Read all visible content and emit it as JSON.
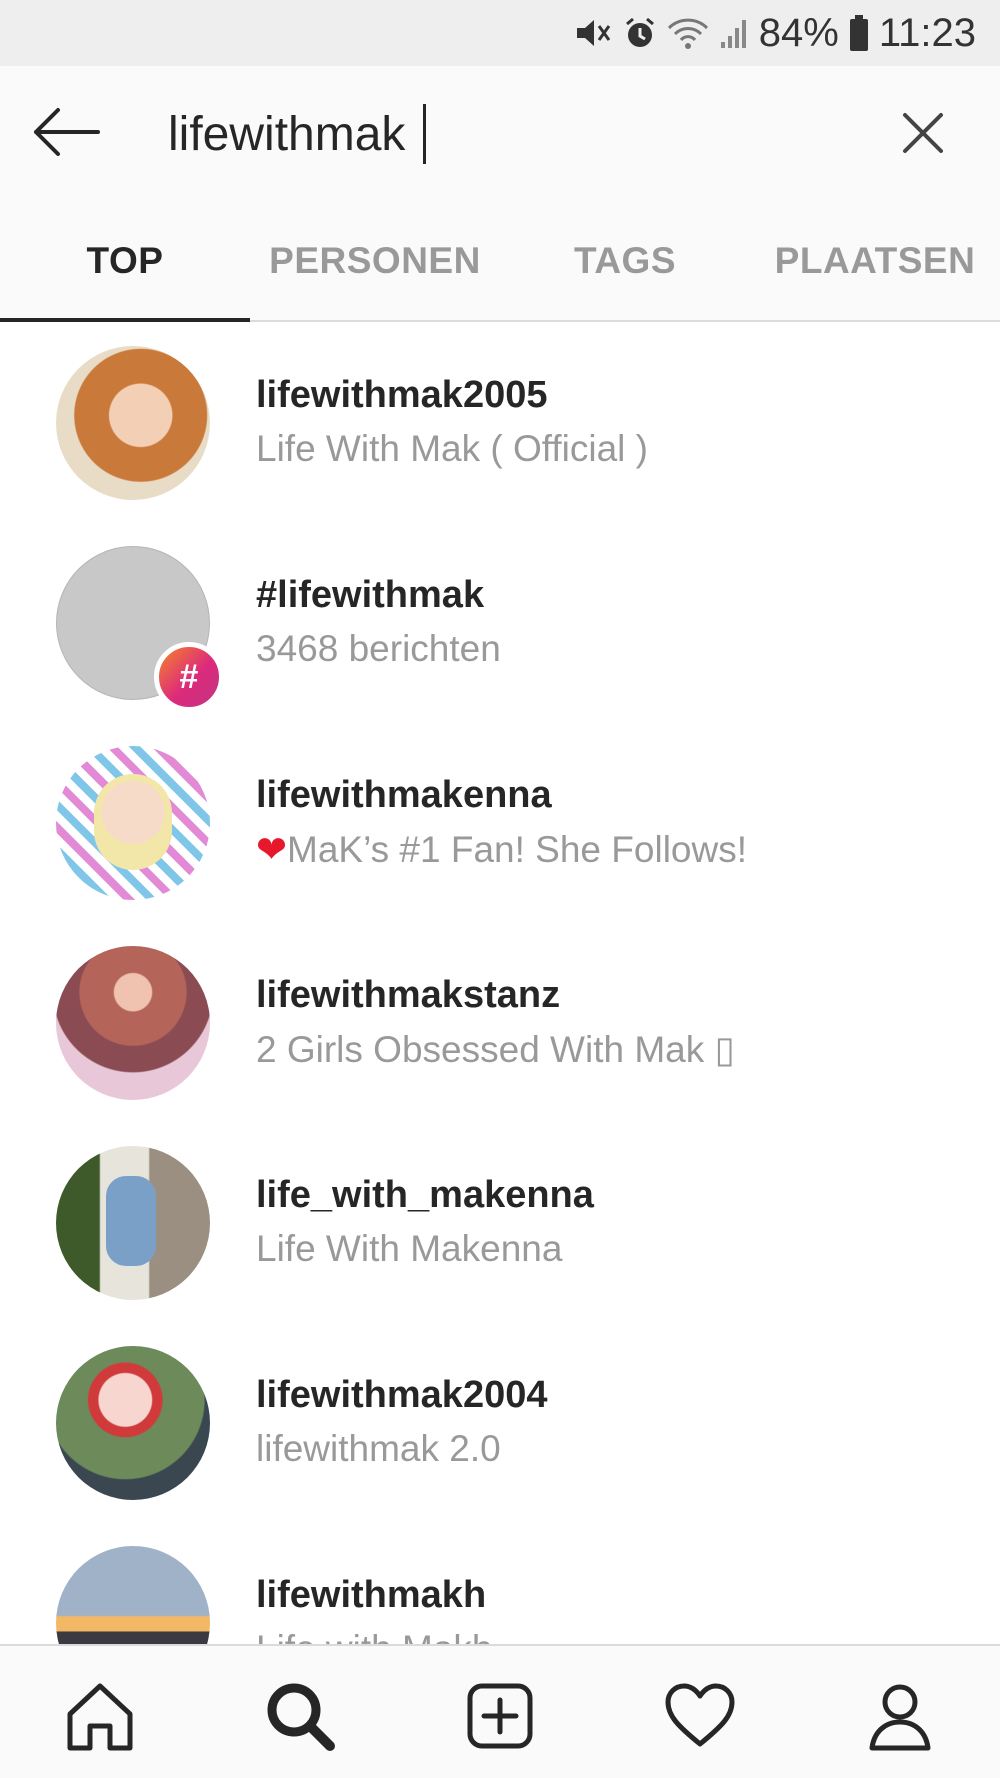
{
  "status_bar": {
    "battery": "84%",
    "time": "11:23",
    "icons": [
      "mute-icon",
      "alarm-icon",
      "wifi-icon",
      "signal-icon",
      "battery-icon"
    ]
  },
  "search": {
    "value": "lifewithmak"
  },
  "tabs": [
    {
      "label": "TOP",
      "active": true
    },
    {
      "label": "PERSONEN",
      "active": false
    },
    {
      "label": "TAGS",
      "active": false
    },
    {
      "label": "PLAATSEN",
      "active": false
    }
  ],
  "results": [
    {
      "username": "lifewithmak2005",
      "subtitle": "Life With Mak ( Official )"
    },
    {
      "username": "#lifewithmak",
      "subtitle": "3468 berichten",
      "badge": "#"
    },
    {
      "username": "lifewithmakenna",
      "subtitle": "MaK’s #1 Fan! She Follows!"
    },
    {
      "username": "lifewithmakstanz",
      "subtitle": "2 Girls Obsessed With Mak ▯"
    },
    {
      "username": "life_with_makenna",
      "subtitle": "Life With Makenna"
    },
    {
      "username": "lifewithmak2004",
      "subtitle": "lifewithmak 2.0"
    },
    {
      "username": "lifewithmakh",
      "subtitle": "Life with Makh"
    }
  ],
  "bottom_nav": [
    "home-icon",
    "search-icon",
    "add-post-icon",
    "activity-heart-icon",
    "profile-icon"
  ],
  "colors": {
    "text_primary": "#262626",
    "text_secondary": "#999999",
    "heart": "#e8182c",
    "hashtag_gradient_start": "#f58529",
    "hashtag_gradient_end": "#c13584"
  }
}
